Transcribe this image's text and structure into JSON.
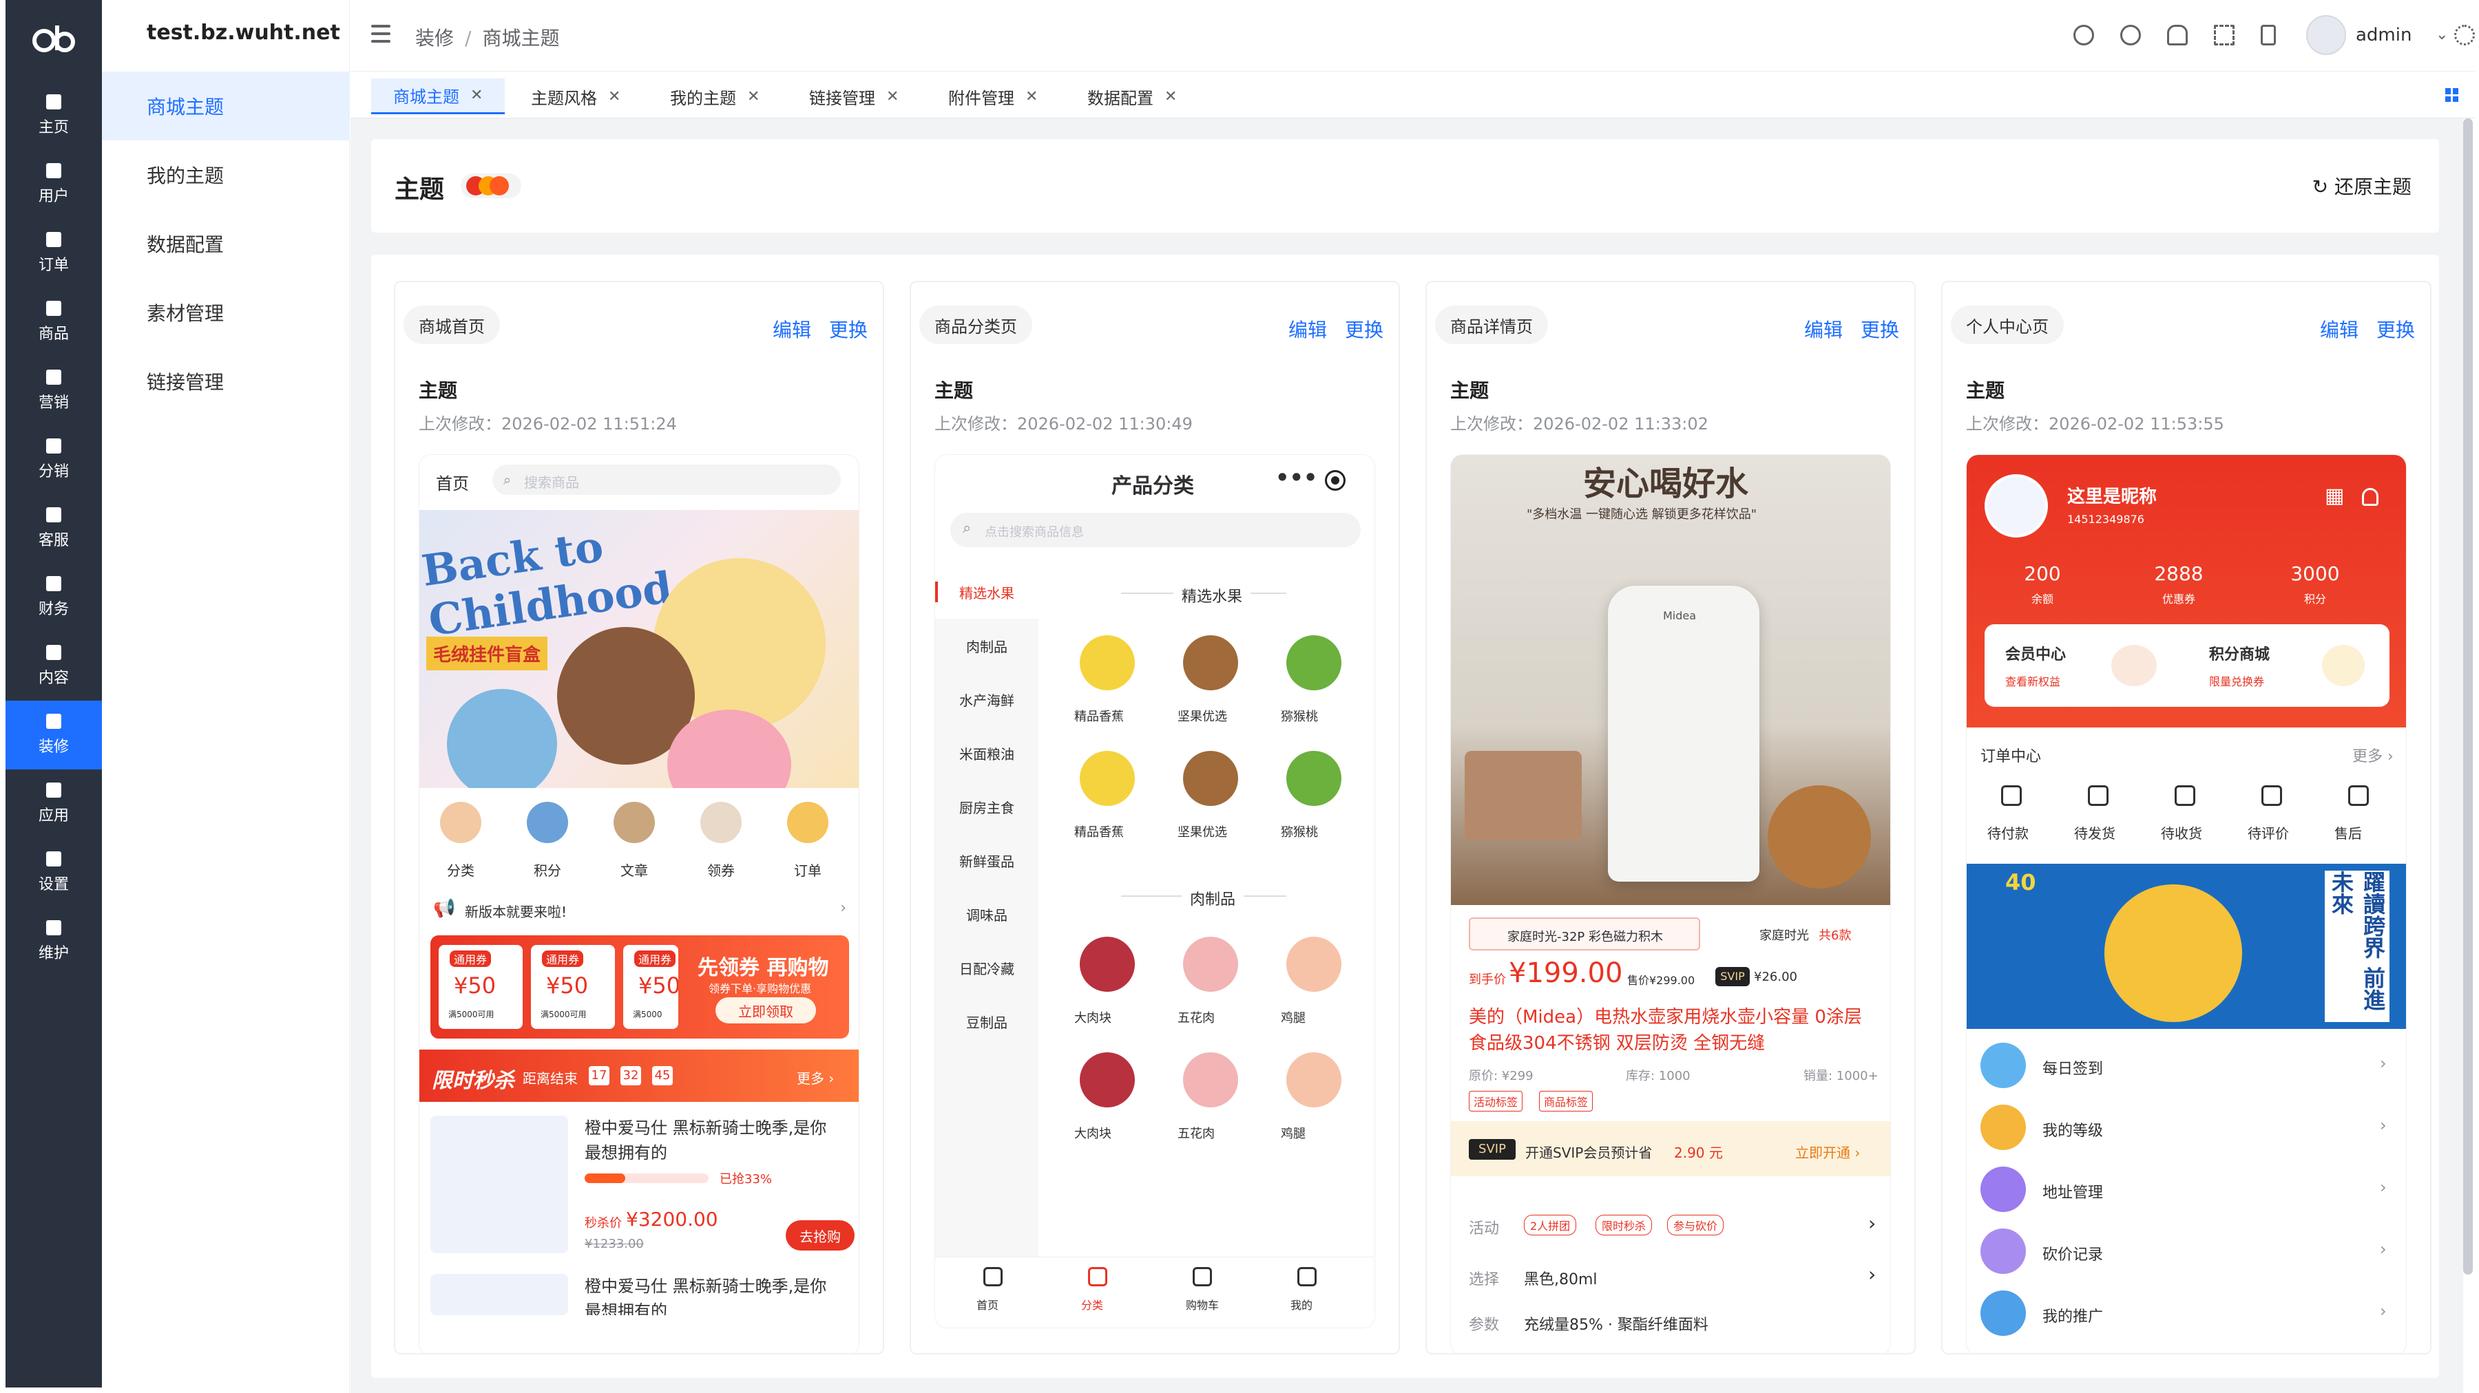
{
  "site": "test.bz.wuht.net",
  "rail": {
    "items": [
      {
        "label": "主页",
        "icon": "home-icon"
      },
      {
        "label": "用户",
        "icon": "user-icon"
      },
      {
        "label": "订单",
        "icon": "order-icon"
      },
      {
        "label": "商品",
        "icon": "goods-icon"
      },
      {
        "label": "营销",
        "icon": "marketing-icon"
      },
      {
        "label": "分销",
        "icon": "distribution-icon"
      },
      {
        "label": "客服",
        "icon": "service-icon"
      },
      {
        "label": "财务",
        "icon": "finance-icon"
      },
      {
        "label": "内容",
        "icon": "content-icon"
      },
      {
        "label": "装修",
        "icon": "decoration-icon"
      },
      {
        "label": "应用",
        "icon": "apps-icon"
      },
      {
        "label": "设置",
        "icon": "settings-icon"
      },
      {
        "label": "维护",
        "icon": "maintenance-icon"
      }
    ]
  },
  "menu": {
    "items": [
      "商城主题",
      "我的主题",
      "数据配置",
      "素材管理",
      "链接管理"
    ]
  },
  "header": {
    "crumb1": "装修",
    "sep": "/",
    "crumb2": "商城主题",
    "user": "admin"
  },
  "tabs": [
    "商城主题",
    "主题风格",
    "我的主题",
    "链接管理",
    "附件管理",
    "数据配置"
  ],
  "titlebar": {
    "title": "主题",
    "restore": "还原主题"
  },
  "cards": [
    {
      "name": "商城首页",
      "edit": "编辑",
      "replace": "更换",
      "theme": "主题",
      "modified": "上次修改：2026-02-02 11:51:24"
    },
    {
      "name": "商品分类页",
      "edit": "编辑",
      "replace": "更换",
      "theme": "主题",
      "modified": "上次修改：2026-02-02 11:30:49"
    },
    {
      "name": "商品详情页",
      "edit": "编辑",
      "replace": "更换",
      "theme": "主题",
      "modified": "上次修改：2026-02-02 11:33:02"
    },
    {
      "name": "个人中心页",
      "edit": "编辑",
      "replace": "更换",
      "theme": "主题",
      "modified": "上次修改：2026-02-02 11:53:55"
    }
  ],
  "home": {
    "tab": "首页",
    "search": "搜索商品",
    "banner_text": "Back to Childhood",
    "banner_sub": "毛绒挂件盲盒",
    "nav": [
      "分类",
      "积分",
      "文章",
      "领券",
      "订单"
    ],
    "notice": "新版本就要来啦!",
    "coupons": [
      {
        "tag": "通用券",
        "value": "¥50",
        "cond": "满5000可用"
      },
      {
        "tag": "通用券",
        "value": "¥50",
        "cond": "满5000可用"
      },
      {
        "tag": "通用券",
        "value": "¥50",
        "cond": "满5000"
      }
    ],
    "coupon_title": "先领券 再购物",
    "coupon_sub": "领券下单·享购物优惠",
    "coupon_btn": "立即领取",
    "seckill_title": "限时秒杀",
    "seckill_end": "距离结束",
    "seckill_h": "17",
    "seckill_m": "32",
    "seckill_s": "45",
    "seckill_more": "更多",
    "item_title": "橙中爱马仕 黑标新骑士晚季,是你最想拥有的",
    "item_progress": "已抢33%",
    "item_price_label": "秒杀价",
    "item_price": "¥3200.00",
    "item_old": "¥1233.00",
    "item_btn": "去抢购",
    "item2_title": "橙中爱马仕 黑标新骑士晚季,是你最想拥有的"
  },
  "category": {
    "title": "产品分类",
    "search": "点击搜索商品信息",
    "left": [
      "精选水果",
      "肉制品",
      "水产海鲜",
      "米面粮油",
      "厨房主食",
      "新鲜蛋品",
      "调味品",
      "日配冷藏",
      "豆制品"
    ],
    "sec1": "精选水果",
    "fruits": [
      "精品香蕉",
      "坚果优选",
      "猕猴桃",
      "精品香蕉",
      "坚果优选",
      "猕猴桃"
    ],
    "sec2": "肉制品",
    "meats": [
      "大肉块",
      "五花肉",
      "鸡腿",
      "大肉块",
      "五花肉",
      "鸡腿"
    ],
    "bottom": [
      "首页",
      "分类",
      "购物车",
      "我的"
    ]
  },
  "detail": {
    "banner_title": "安心喝好水",
    "banner_sub": "\"多档水温 一键随心选 解锁更多花样饮品\"",
    "brand": "Midea",
    "tag1": "家庭时光-32P 彩色磁力积木",
    "tag2": "家庭时光",
    "tag2_count": "共6款",
    "price_label": "到手价",
    "price": "¥199.00",
    "price_orig": "售价¥299.00",
    "svip": "SVIP",
    "svip_price": "¥26.00",
    "title": "美的（Midea）电热水壶家用烧水壶小容量 0涂层 食品级304不锈钢 双层防烫 全钢无缝",
    "orig": "原价: ¥299",
    "stock": "库存: 1000",
    "sales": "销量: 1000+",
    "lbl1": "活动标签",
    "lbl2": "商品标签",
    "svip_bar": "开通SVIP会员预计省",
    "svip_save": "2.90 元",
    "svip_btn": "立即开通",
    "act_label": "活动",
    "acts": [
      "2人拼团",
      "限时秒杀",
      "参与砍价"
    ],
    "sel_label": "选择",
    "sel_value": "黑色,80ml",
    "param_label": "参数",
    "param_value": "充绒量85% · 聚酯纤维面料"
  },
  "user": {
    "nickname": "这里是昵称",
    "uid": "14512349876",
    "stats": [
      {
        "num": "200",
        "label": "余额"
      },
      {
        "num": "2888",
        "label": "优惠券"
      },
      {
        "num": "3000",
        "label": "积分"
      }
    ],
    "vip_title": "会员中心",
    "vip_sub": "查看新权益",
    "pts_title": "积分商城",
    "pts_sub": "限量兑换券",
    "order_center": "订单中心",
    "more": "更多",
    "orders": [
      "待付款",
      "待发货",
      "待收货",
      "待评价",
      "售后"
    ],
    "poster_num": "40",
    "poster_text": "躍讀跨界 前進未來",
    "services": [
      "每日签到",
      "我的等级",
      "地址管理",
      "砍价记录",
      "我的推广"
    ]
  }
}
